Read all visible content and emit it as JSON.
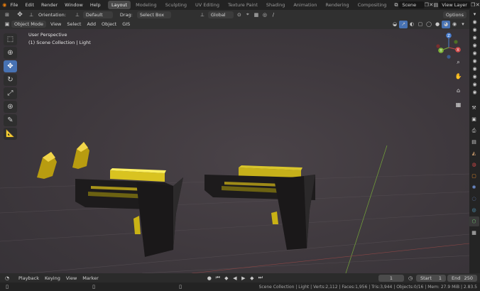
{
  "menu": {
    "items": [
      "File",
      "Edit",
      "Render",
      "Window",
      "Help"
    ]
  },
  "workspaces": {
    "tabs": [
      "Layout",
      "Modeling",
      "Sculpting",
      "UV Editing",
      "Texture Paint",
      "Shading",
      "Animation",
      "Rendering",
      "Compositing"
    ],
    "active": "Layout"
  },
  "scene": {
    "label": "Scene"
  },
  "view_layer": {
    "label": "View Layer"
  },
  "tool_settings": {
    "orientation_label": "Orientation:",
    "orientation_value": "Default",
    "drag_label": "Drag:",
    "drag_value": "Select Box",
    "transform_orientation": "Global",
    "options_label": "Options"
  },
  "header": {
    "mode": "Object Mode",
    "menus": [
      "View",
      "Select",
      "Add",
      "Object",
      "GIS"
    ]
  },
  "viewport": {
    "perspective_label": "User Perspective",
    "collection_label": "(1) Scene Collection | Light",
    "accent_color": "#4772b3",
    "object_color": "#c9b215"
  },
  "gizmo": {
    "x": "X",
    "y": "Y",
    "z": "Z"
  },
  "timeline": {
    "menus": [
      "Playback",
      "Keying",
      "View",
      "Marker"
    ],
    "current_frame": "1",
    "start_label": "Start",
    "start_value": "1",
    "end_label": "End",
    "end_value": "250"
  },
  "status": {
    "text": "Scene Collection | Light | Verts:2,112 | Faces:1,956 | Tris:3,944 | Objects:0/16 | Mem: 27.9 MiB | 2.83.5"
  },
  "icons": {
    "tools": [
      "select-tweak-icon",
      "cursor-icon",
      "move-icon",
      "rotate-icon",
      "scale-icon",
      "transform-icon",
      "annotate-icon",
      "measure-icon"
    ]
  }
}
